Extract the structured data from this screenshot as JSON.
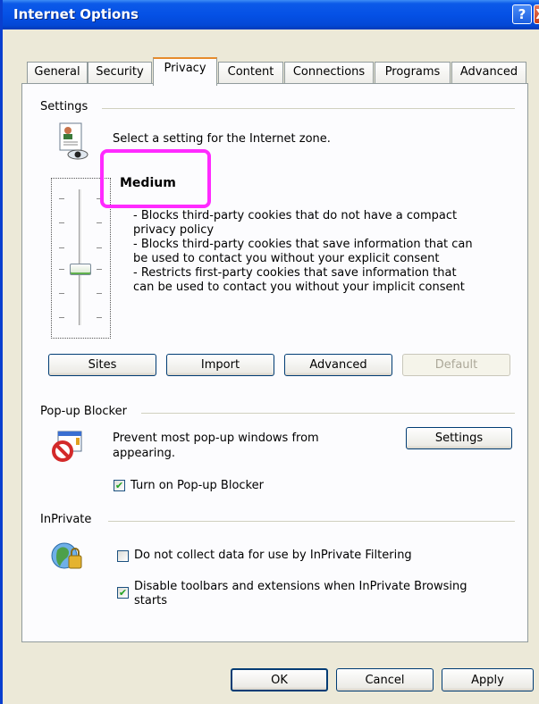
{
  "window": {
    "title": "Internet Options",
    "help_glyph": "?",
    "close_glyph": "X"
  },
  "tabs": [
    {
      "label": "General"
    },
    {
      "label": "Security"
    },
    {
      "label": "Privacy",
      "active": true
    },
    {
      "label": "Content"
    },
    {
      "label": "Connections"
    },
    {
      "label": "Programs"
    },
    {
      "label": "Advanced"
    }
  ],
  "settings": {
    "group_label": "Settings",
    "instruction": "Select a setting for the Internet zone.",
    "level": "Medium",
    "description": [
      "- Blocks third-party cookies that do not have a compact",
      "privacy policy",
      "- Blocks third-party cookies that save information that can",
      "be used to contact you without your explicit consent",
      "- Restricts first-party cookies that save information that",
      "can be used to contact you without your implicit consent"
    ],
    "buttons": {
      "sites": "Sites",
      "import": "Import",
      "advanced": "Advanced",
      "default": "Default"
    }
  },
  "popup_blocker": {
    "group_label": "Pop-up Blocker",
    "description_line1": "Prevent most pop-up windows from",
    "description_line2": "appearing.",
    "settings_button": "Settings",
    "checkbox_label": "Turn on Pop-up Blocker",
    "checked": true
  },
  "inprivate": {
    "group_label": "InPrivate",
    "filtering_label": "Do not collect data for use by InPrivate Filtering",
    "filtering_checked": false,
    "disable_toolbars_line1": "Disable toolbars and extensions when InPrivate Browsing",
    "disable_toolbars_line2": "starts",
    "disable_toolbars_checked": true
  },
  "footer": {
    "ok": "OK",
    "cancel": "Cancel",
    "apply": "Apply"
  },
  "colors": {
    "title_bar": "#0551e6",
    "annotation": "#ff2aff",
    "active_tab_accent": "#e68b2c"
  }
}
